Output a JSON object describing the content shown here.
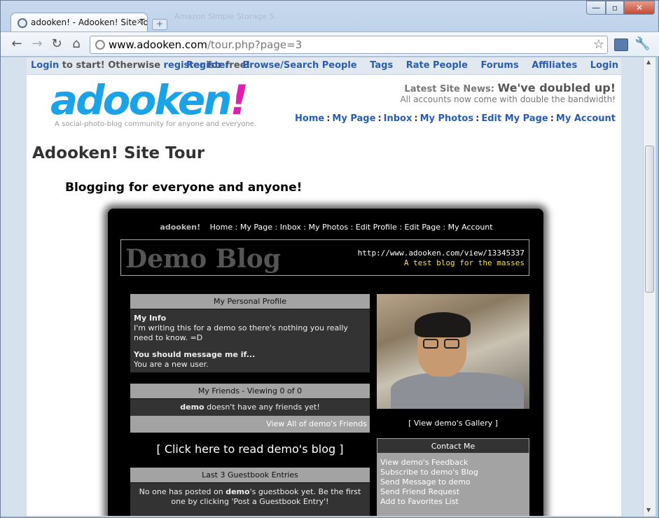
{
  "browser": {
    "tab_title": "adooken! - Adooken! Site Tour",
    "ghost_tab_title": "Amazon Simple Storage S...",
    "new_tab_symbol": "+",
    "url_domain": "www.adooken.com",
    "url_path": "/tour.php?page=3",
    "back": "←",
    "forward": "→",
    "reload": "↻",
    "home": "⌂",
    "star": "☆",
    "wrench": "🔧",
    "minimize": "—",
    "maximize": "▫",
    "close": "✕"
  },
  "site": {
    "topbar": {
      "login_link": "Login",
      "mid_text": " to start! Otherwise ",
      "register_link": "register",
      "end_text": " for free!",
      "links": [
        "Register",
        "Browse/Search People",
        "Tags",
        "Rate People",
        "Forums",
        "Affiliates",
        "Login"
      ]
    },
    "logo": {
      "part1": "adooken",
      "part2": "!"
    },
    "tagline": "A social-photo-blog community for anyone and everyone.",
    "news_label": "Latest Site News:",
    "news_headline": "We've doubled up!",
    "news_detail": "All accounts now come with double the bandwidth!",
    "main_nav": [
      "Home",
      "My Page",
      "Inbox",
      "My Photos",
      "Edit My Page",
      "My Account"
    ],
    "page_title": "Adooken! Site Tour",
    "section_heading": "Blogging for everyone and anyone!"
  },
  "demo": {
    "brand": "adooken!",
    "nav": [
      "Home",
      "My Page",
      "Inbox",
      "My Photos",
      "Edit Profile",
      "Edit Page",
      "My Account"
    ],
    "blog_title": "Demo Blog",
    "blog_url": "http://www.adooken.com/view/13345337",
    "blog_subtitle": "A test blog for the masses",
    "profile": {
      "header": "My Personal Profile",
      "info_label": "My Info",
      "info_text": "I'm writing this for a demo so there's nothing you really need to know. =D",
      "message_label": "You should message me if...",
      "message_text": "You are a new user."
    },
    "friends": {
      "header": "My Friends - Viewing 0 of 0",
      "user": "demo",
      "empty_text": " doesn't have any friends yet!",
      "view_all": "View All of demo's Friends"
    },
    "read_blog": "[ Click here to read demo's blog ]",
    "guestbook": {
      "header": "Last 3 Guestbook Entries",
      "text_before": "No one has posted on ",
      "user": "demo",
      "text_after": "'s guestbook yet. Be the first one by clicking 'Post a Guestbook Entry'!"
    },
    "gallery_link": "[ View demo's Gallery ]",
    "contact": {
      "header": "Contact Me",
      "items": [
        "View demo's Feedback",
        "Subscribe to demo's Blog",
        "Send Message to demo",
        "Send Friend Request",
        "Add to Favorites List"
      ]
    }
  }
}
